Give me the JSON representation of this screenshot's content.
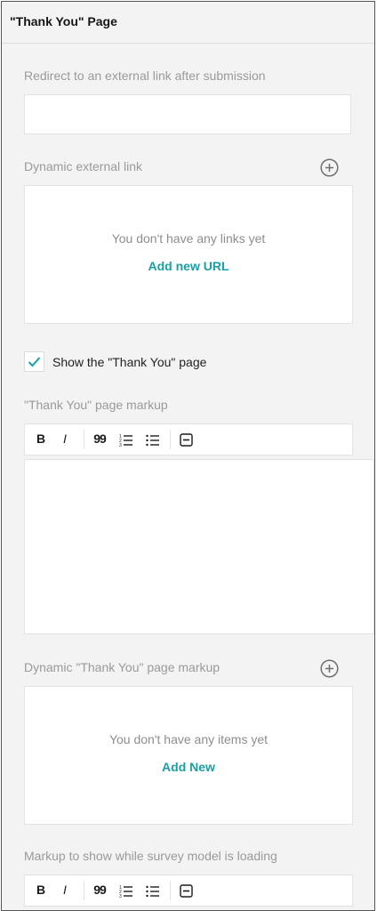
{
  "header": {
    "title": "\"Thank You\" Page"
  },
  "redirect": {
    "label": "Redirect to an external link after submission",
    "value": ""
  },
  "dynamic_link": {
    "label": "Dynamic external link",
    "add_icon": "plus-circle-icon",
    "empty_text": "You don't have any links yet",
    "add_link": "Add new URL"
  },
  "show_thank_you": {
    "label": "Show the \"Thank You\" page",
    "checked": true,
    "check_icon": "checkmark-icon"
  },
  "markup": {
    "label": "\"Thank You\" page markup",
    "toolbar": {
      "bold": "B",
      "italic": "I",
      "quote": "99",
      "ordered_list_icon": "ordered-list-icon",
      "bullet_list_icon": "bullet-list-icon",
      "separator_icon": "horizontal-rule-icon"
    },
    "value": ""
  },
  "dynamic_markup": {
    "label": "Dynamic \"Thank You\" page markup",
    "add_icon": "plus-circle-icon",
    "empty_text": "You don't have any items yet",
    "add_link": "Add New"
  },
  "loading_markup": {
    "label": "Markup to show while survey model is loading",
    "toolbar": {
      "bold": "B",
      "italic": "I",
      "quote": "99",
      "ordered_list_icon": "ordered-list-icon",
      "bullet_list_icon": "bullet-list-icon",
      "separator_icon": "horizontal-rule-icon"
    }
  },
  "colors": {
    "accent": "#19a0a5",
    "panel_background": "#f3f3f3",
    "label_text": "#9a9a9a"
  }
}
